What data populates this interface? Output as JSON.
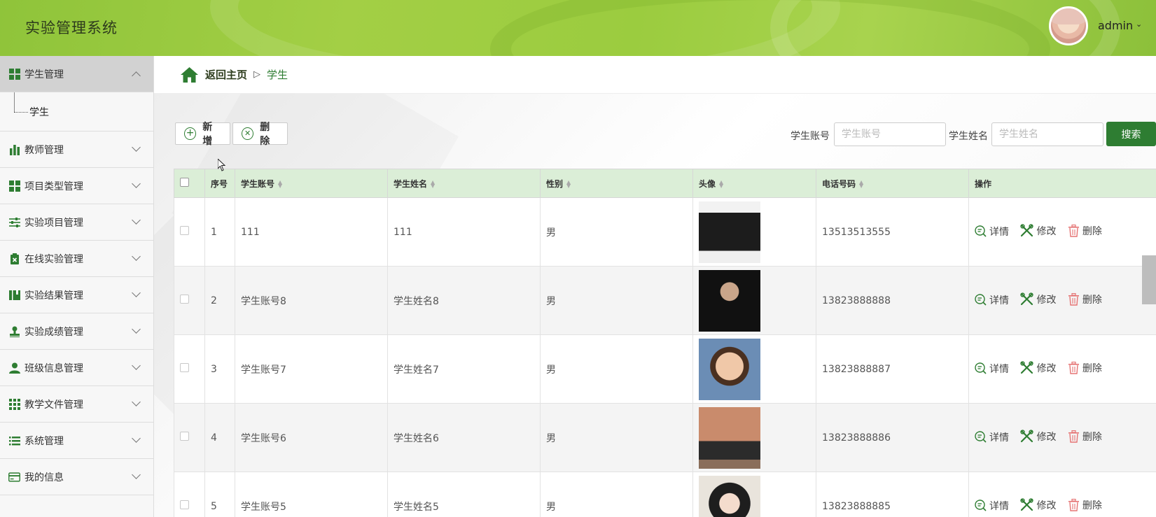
{
  "app": {
    "title": "实验管理系统"
  },
  "user": {
    "name": "admin",
    "caret": "⌄"
  },
  "sidebar": {
    "groups": [
      {
        "label": "学生管理",
        "icon": "grid-icon",
        "expanded": true,
        "children": [
          {
            "label": "学生"
          }
        ]
      },
      {
        "label": "教师管理",
        "icon": "bar-chart-icon"
      },
      {
        "label": "项目类型管理",
        "icon": "grid-icon"
      },
      {
        "label": "实验项目管理",
        "icon": "sliders-icon"
      },
      {
        "label": "在线实验管理",
        "icon": "clipboard-x-icon"
      },
      {
        "label": "实验结果管理",
        "icon": "book-icon"
      },
      {
        "label": "实验成绩管理",
        "icon": "stamp-icon"
      },
      {
        "label": "班级信息管理",
        "icon": "person-icon"
      },
      {
        "label": "教学文件管理",
        "icon": "apps-icon"
      },
      {
        "label": "系统管理",
        "icon": "list-icon"
      },
      {
        "label": "我的信息",
        "icon": "card-icon"
      }
    ]
  },
  "breadcrumb": {
    "home": "返回主页",
    "separator": "▷",
    "current": "学生"
  },
  "toolbar": {
    "add_label": "新增",
    "delete_label": "删除"
  },
  "search": {
    "account_label": "学生账号",
    "account_placeholder": "学生账号",
    "name_label": "学生姓名",
    "name_placeholder": "学生姓名",
    "button_label": "搜索"
  },
  "table": {
    "headers": [
      "序号",
      "学生账号",
      "学生姓名",
      "性别",
      "头像",
      "电话号码",
      "操作"
    ],
    "actions": {
      "detail": "详情",
      "edit": "修改",
      "delete": "删除"
    },
    "rows": [
      {
        "index": "1",
        "account": "111",
        "name": "111",
        "gender": "男",
        "avatar": "black-tshirt-photo",
        "phone": "13513513555"
      },
      {
        "index": "2",
        "account": "学生账号8",
        "name": "学生姓名8",
        "gender": "男",
        "avatar": "masked-person-photo",
        "phone": "13823888888"
      },
      {
        "index": "3",
        "account": "学生账号7",
        "name": "学生姓名7",
        "gender": "男",
        "avatar": "cartoon-boy-photo",
        "phone": "13823888887"
      },
      {
        "index": "4",
        "account": "学生账号6",
        "name": "学生姓名6",
        "gender": "男",
        "avatar": "sitting-person-photo",
        "phone": "13823888886"
      },
      {
        "index": "5",
        "account": "学生账号5",
        "name": "学生姓名5",
        "gender": "男",
        "avatar": "girl-portrait-photo",
        "phone": "13823888885"
      }
    ]
  },
  "colors": {
    "accent": "#2e7d32",
    "header_green": "#9bcc3f",
    "table_head": "#dbeed7",
    "delete_red": "#e57373"
  }
}
